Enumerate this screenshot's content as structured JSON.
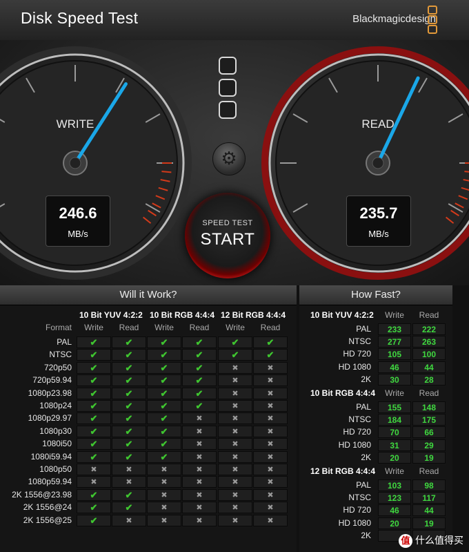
{
  "app": {
    "title": "Disk Speed Test",
    "brand": "Blackmagicdesign",
    "brand_color": "#e39a3a"
  },
  "gauges": {
    "write": {
      "label": "WRITE",
      "value": "246.6",
      "unit": "MB/s"
    },
    "read": {
      "label": "READ",
      "value": "235.7",
      "unit": "MB/s"
    }
  },
  "controls": {
    "start_small": "SPEED TEST",
    "start_big": "START",
    "settings_icon": "gear-icon",
    "lamp_count": 3
  },
  "will_it_work": {
    "title": "Will it Work?",
    "format_header": "Format",
    "groups": [
      {
        "name": "10 Bit YUV 4:2:2",
        "cols": [
          "Write",
          "Read"
        ]
      },
      {
        "name": "10 Bit RGB 4:4:4",
        "cols": [
          "Write",
          "Read"
        ]
      },
      {
        "name": "12 Bit RGB 4:4:4",
        "cols": [
          "Write",
          "Read"
        ]
      }
    ],
    "rows": [
      {
        "format": "PAL",
        "r": [
          1,
          1,
          1,
          1,
          1,
          1
        ]
      },
      {
        "format": "NTSC",
        "r": [
          1,
          1,
          1,
          1,
          1,
          1
        ]
      },
      {
        "format": "720p50",
        "r": [
          1,
          1,
          1,
          1,
          0,
          0
        ]
      },
      {
        "format": "720p59.94",
        "r": [
          1,
          1,
          1,
          1,
          0,
          0
        ]
      },
      {
        "format": "1080p23.98",
        "r": [
          1,
          1,
          1,
          1,
          0,
          0
        ]
      },
      {
        "format": "1080p24",
        "r": [
          1,
          1,
          1,
          1,
          0,
          0
        ]
      },
      {
        "format": "1080p29.97",
        "r": [
          1,
          1,
          1,
          0,
          0,
          0
        ]
      },
      {
        "format": "1080p30",
        "r": [
          1,
          1,
          1,
          0,
          0,
          0
        ]
      },
      {
        "format": "1080i50",
        "r": [
          1,
          1,
          1,
          0,
          0,
          0
        ]
      },
      {
        "format": "1080i59.94",
        "r": [
          1,
          1,
          1,
          0,
          0,
          0
        ]
      },
      {
        "format": "1080p50",
        "r": [
          0,
          0,
          0,
          0,
          0,
          0
        ]
      },
      {
        "format": "1080p59.94",
        "r": [
          0,
          0,
          0,
          0,
          0,
          0
        ]
      },
      {
        "format": "2K 1556@23.98",
        "r": [
          1,
          1,
          0,
          0,
          0,
          0
        ]
      },
      {
        "format": "2K 1556@24",
        "r": [
          1,
          1,
          0,
          0,
          0,
          0
        ]
      },
      {
        "format": "2K 1556@25",
        "r": [
          1,
          0,
          0,
          0,
          0,
          0
        ]
      }
    ],
    "check_glyph": "✔",
    "cross_glyph": "✖"
  },
  "how_fast": {
    "title": "How Fast?",
    "col_write": "Write",
    "col_read": "Read",
    "sections": [
      {
        "name": "10 Bit YUV 4:2:2",
        "rows": [
          {
            "format": "PAL",
            "write": "233",
            "read": "222"
          },
          {
            "format": "NTSC",
            "write": "277",
            "read": "263"
          },
          {
            "format": "HD 720",
            "write": "105",
            "read": "100"
          },
          {
            "format": "HD 1080",
            "write": "46",
            "read": "44"
          },
          {
            "format": "2K",
            "write": "30",
            "read": "28"
          }
        ]
      },
      {
        "name": "10 Bit RGB 4:4:4",
        "rows": [
          {
            "format": "PAL",
            "write": "155",
            "read": "148"
          },
          {
            "format": "NTSC",
            "write": "184",
            "read": "175"
          },
          {
            "format": "HD 720",
            "write": "70",
            "read": "66"
          },
          {
            "format": "HD 1080",
            "write": "31",
            "read": "29"
          },
          {
            "format": "2K",
            "write": "20",
            "read": "19"
          }
        ]
      },
      {
        "name": "12 Bit RGB 4:4:4",
        "rows": [
          {
            "format": "PAL",
            "write": "103",
            "read": "98"
          },
          {
            "format": "NTSC",
            "write": "123",
            "read": "117"
          },
          {
            "format": "HD 720",
            "write": "46",
            "read": "44"
          },
          {
            "format": "HD 1080",
            "write": "20",
            "read": "19"
          },
          {
            "format": "2K",
            "write": "",
            "read": ""
          }
        ]
      }
    ]
  },
  "watermark": {
    "badge": "值",
    "text": "什么值得买"
  }
}
